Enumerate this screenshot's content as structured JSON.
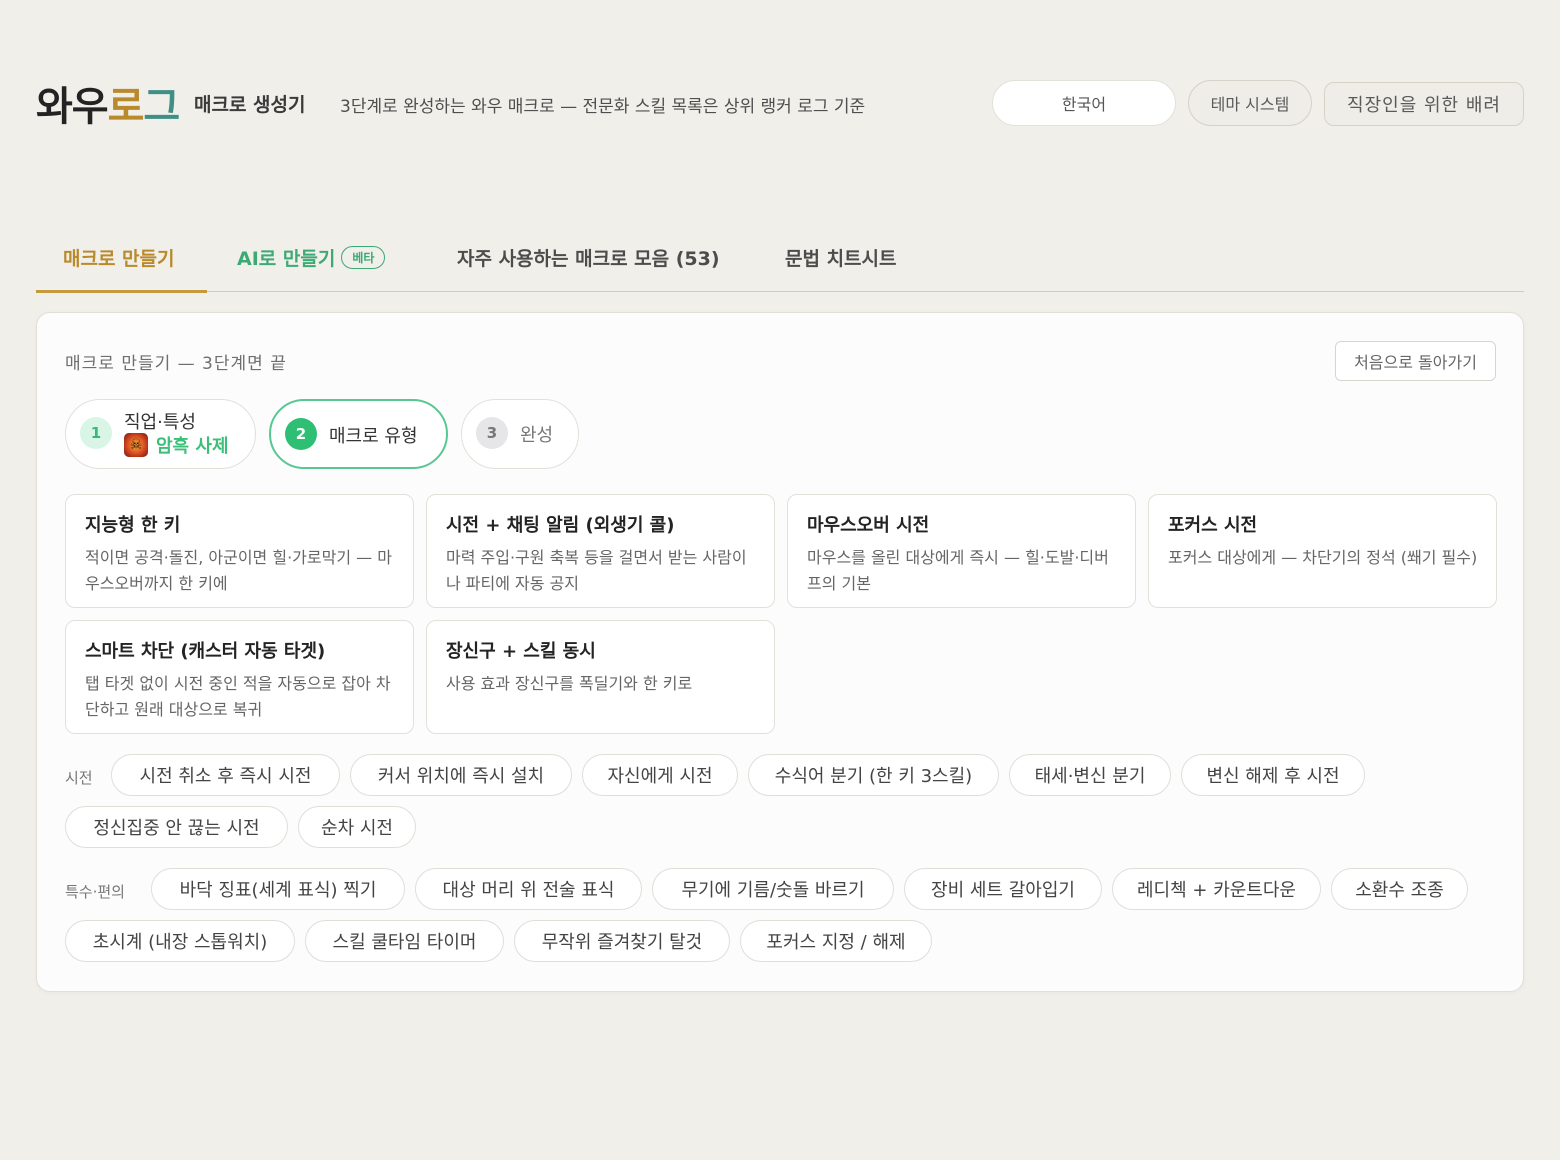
{
  "header": {
    "logo": [
      "와우",
      "로",
      "그"
    ],
    "subtitle": "매크로 생성기",
    "tagline": "3단계로 완성하는 와우 매크로 — 전문화 스킬 목록은 상위 랭커 로그 기준",
    "language": "한국어",
    "theme": "테마 시스템",
    "office_mode": "직장인을 위한 배려"
  },
  "tabs": [
    {
      "label": "매크로 만들기",
      "active": true
    },
    {
      "label": "AI로 만들기",
      "badge": "베타"
    },
    {
      "label": "자주 사용하는 매크로 모음 (53)"
    },
    {
      "label": "문법 치트시트"
    }
  ],
  "panel": {
    "title": "매크로 만들기 — 3단계면 끝",
    "restart": "처음으로 돌아가기",
    "steps": [
      {
        "num": "1",
        "label": "직업·특성",
        "sub": "암흑 사제",
        "icon": "shadow-priest-icon"
      },
      {
        "num": "2",
        "label": "매크로 유형"
      },
      {
        "num": "3",
        "label": "완성"
      }
    ],
    "cards": [
      {
        "title": "지능형 한 키",
        "desc": "적이면 공격·돌진, 아군이면 힐·가로막기 — 마우스오버까지 한 키에"
      },
      {
        "title": "시전 + 채팅 알림 (외생기 콜)",
        "desc": "마력 주입·구원 축복 등을 걸면서 받는 사람이나 파티에 자동 공지"
      },
      {
        "title": "마우스오버 시전",
        "desc": "마우스를 올린 대상에게 즉시 — 힐·도발·디버프의 기본"
      },
      {
        "title": "포커스 시전",
        "desc": "포커스 대상에게 — 차단기의 정석 (쐐기 필수)"
      },
      {
        "title": "스마트 차단 (캐스터 자동 타겟)",
        "desc": "탭 타겟 없이 시전 중인 적을 자동으로 잡아 차단하고 원래 대상으로 복귀"
      },
      {
        "title": "장신구 + 스킬 동시",
        "desc": "사용 효과 장신구를 폭딜기와 한 키로"
      }
    ],
    "cast_label": "시전",
    "cast_chips": [
      "시전 취소 후 즉시 시전",
      "커서 위치에 즉시 설치",
      "자신에게 시전",
      "수식어 분기 (한 키 3스킬)",
      "태세·변신 분기",
      "변신 해제 후 시전",
      "정신집중 안 끊는 시전",
      "순차 시전"
    ],
    "special_label": "특수·편의",
    "special_chips": [
      "바닥 징표(세계 표식) 찍기",
      "대상 머리 위 전술 표식",
      "무기에 기름/숫돌 바르기",
      "장비 세트 갈아입기",
      "레디첵 + 카운트다운",
      "소환수 조종",
      "초시계 (내장 스톱워치)",
      "스킬 쿨타임 타이머",
      "무작위 즐겨찾기 탈것",
      "포커스 지정 / 해제"
    ]
  },
  "colors": {
    "accent_gold": "#b98a2c",
    "accent_green": "#3daa76",
    "logo_teal": "#3f8f86"
  }
}
